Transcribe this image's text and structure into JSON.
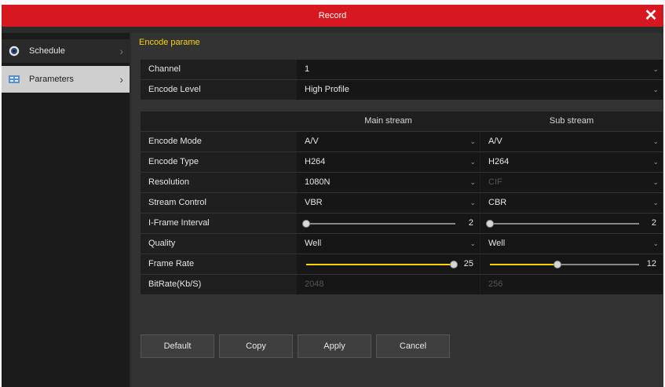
{
  "window": {
    "title": "Record",
    "close_icon": "close-icon"
  },
  "sidebar": {
    "items": [
      {
        "label": "Schedule",
        "icon": "schedule-icon"
      },
      {
        "label": "Parameters",
        "icon": "parameters-icon"
      }
    ]
  },
  "main": {
    "section_title": "Encode parame",
    "channel": {
      "label": "Channel",
      "value": "1"
    },
    "encode_level": {
      "label": "Encode Level",
      "value": "High Profile"
    },
    "headers": {
      "main": "Main stream",
      "sub": "Sub stream"
    },
    "rows": {
      "encode_mode": {
        "label": "Encode Mode",
        "main": "A/V",
        "sub": "A/V"
      },
      "encode_type": {
        "label": "Encode Type",
        "main": "H264",
        "sub": "H264"
      },
      "resolution": {
        "label": "Resolution",
        "main": "1080N",
        "sub": "CIF"
      },
      "stream_control": {
        "label": "Stream Control",
        "main": "VBR",
        "sub": "CBR"
      },
      "iframe": {
        "label": "I-Frame Interval",
        "main": "2",
        "sub": "2",
        "main_level": 0.0,
        "sub_level": 0.0
      },
      "quality": {
        "label": "Quality",
        "main": "Well",
        "sub": "Well"
      },
      "frame_rate": {
        "label": "Frame Rate",
        "main": "25",
        "sub": "12",
        "main_level": 1.0,
        "sub_level": 0.45
      },
      "bitrate": {
        "label": "BitRate(Kb/S)",
        "main": "2048",
        "sub": "256"
      }
    }
  },
  "buttons": {
    "default": "Default",
    "copy": "Copy",
    "apply": "Apply",
    "cancel": "Cancel"
  }
}
